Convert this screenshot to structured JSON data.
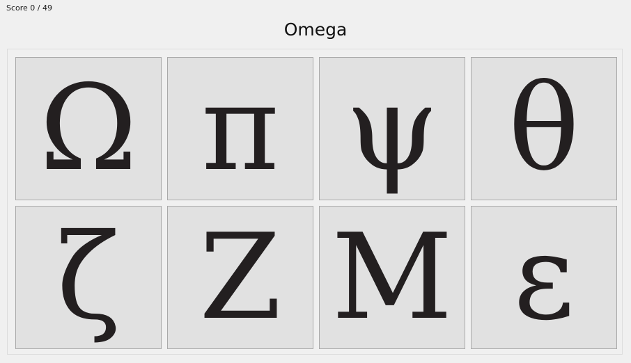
{
  "score": {
    "text": "Score 0 / 49"
  },
  "prompt": {
    "text": "Omega"
  },
  "tiles": [
    {
      "symbol": "Ω",
      "icon": "omega-glyph"
    },
    {
      "symbol": "π",
      "icon": "pi-glyph"
    },
    {
      "symbol": "ψ",
      "icon": "psi-glyph"
    },
    {
      "symbol": "θ",
      "icon": "theta-glyph"
    },
    {
      "symbol": "ζ",
      "icon": "zeta-glyph"
    },
    {
      "symbol": "Z",
      "icon": "capital-zeta-glyph"
    },
    {
      "symbol": "M",
      "icon": "capital-mu-glyph"
    },
    {
      "symbol": "ε",
      "icon": "epsilon-glyph"
    }
  ],
  "colors": {
    "background": "#f0f0f0",
    "tile": "#e1e1e1",
    "tile_border": "#a9a9a9",
    "glyph": "#231f20"
  }
}
